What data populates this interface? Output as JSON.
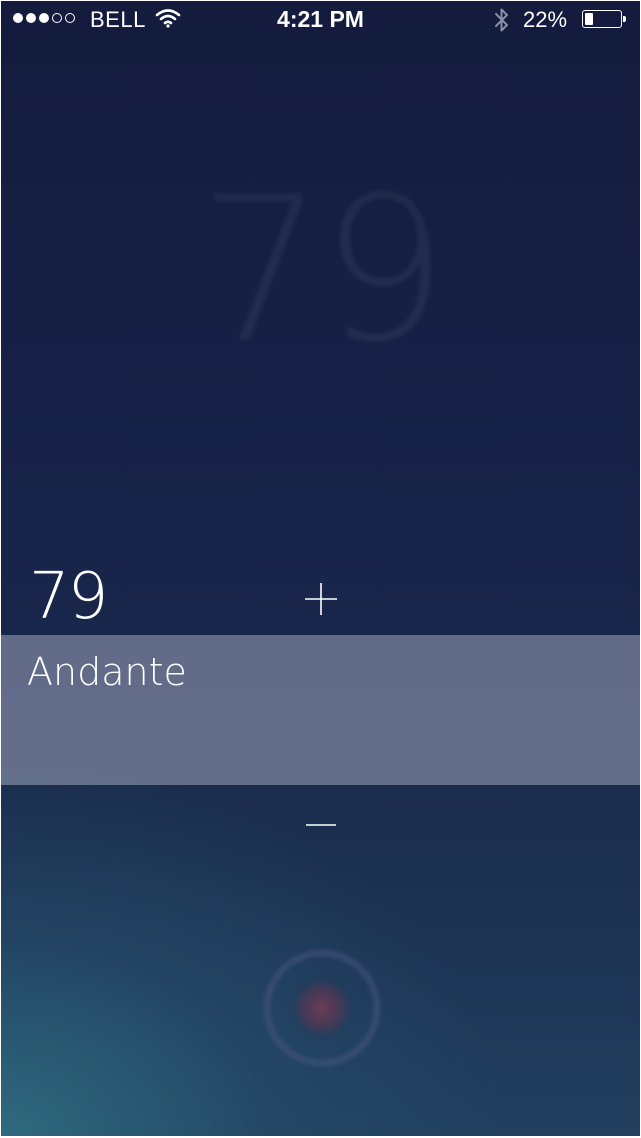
{
  "status_bar": {
    "signal_bars_filled": 3,
    "signal_bars_total": 5,
    "carrier": "BELL",
    "time": "4:21 PM",
    "battery_percent": "22%",
    "battery_level": 0.22,
    "icons": [
      "wifi-icon",
      "bluetooth-icon",
      "battery-icon"
    ]
  },
  "metronome": {
    "ghost_bpm": "79",
    "bpm": "79",
    "increase_label": "+",
    "decrease_label": "−",
    "tempo_name": "Andante"
  },
  "colors": {
    "background_top": "#141b3d",
    "background_bottom": "#2a6078",
    "tempo_band": "#b2b8cd",
    "text": "#ffffff",
    "pulse_core": "#7a3c52"
  }
}
